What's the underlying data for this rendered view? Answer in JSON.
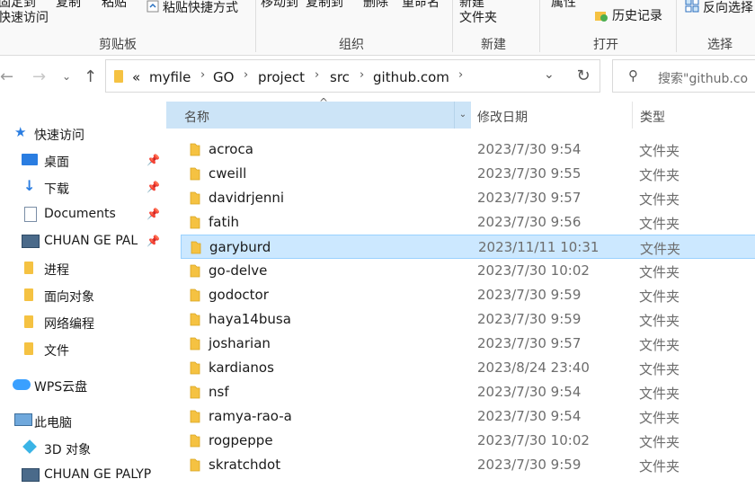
{
  "ribbon": {
    "top_texts": [
      "固定到",
      "复制",
      "粘贴",
      "移动到",
      "复制到",
      "删除",
      "重命名",
      "新建",
      "属性"
    ],
    "pin_quick_access": "快速访问",
    "paste_shortcut": "粘贴快捷方式",
    "new_folder": "文件夹",
    "history": "历史记录",
    "invert_selection": "反向选择",
    "groups": {
      "clipboard": "剪贴板",
      "organize": "组织",
      "new": "新建",
      "open": "打开",
      "select": "选择"
    }
  },
  "address": {
    "overflow": "«",
    "crumbs": [
      "myfile",
      "GO",
      "project",
      "src",
      "github.com"
    ],
    "search_placeholder": "搜索\"github.co"
  },
  "nav": {
    "quick_access": "快速访问",
    "desktop": "桌面",
    "downloads": "下载",
    "documents": "Documents",
    "chuan1": "CHUAN GE PAL",
    "process": "进程",
    "oop": "面向对象",
    "network": "网络编程",
    "file": "文件",
    "wps": "WPS云盘",
    "this_pc": "此电脑",
    "objects3d": "3D 对象",
    "chuan2": "CHUAN GE PALYP"
  },
  "columns": {
    "name": "名称",
    "date": "修改日期",
    "type": "类型"
  },
  "files": [
    {
      "name": "acroca",
      "date": "2023/7/30 9:54",
      "type": "文件夹"
    },
    {
      "name": "cweill",
      "date": "2023/7/30 9:55",
      "type": "文件夹"
    },
    {
      "name": "davidrjenni",
      "date": "2023/7/30 9:57",
      "type": "文件夹"
    },
    {
      "name": "fatih",
      "date": "2023/7/30 9:56",
      "type": "文件夹"
    },
    {
      "name": "garyburd",
      "date": "2023/11/11 10:31",
      "type": "文件夹",
      "selected": true
    },
    {
      "name": "go-delve",
      "date": "2023/7/30 10:02",
      "type": "文件夹"
    },
    {
      "name": "godoctor",
      "date": "2023/7/30 9:59",
      "type": "文件夹"
    },
    {
      "name": "haya14busa",
      "date": "2023/7/30 9:59",
      "type": "文件夹"
    },
    {
      "name": "josharian",
      "date": "2023/7/30 9:57",
      "type": "文件夹"
    },
    {
      "name": "kardianos",
      "date": "2023/8/24 23:40",
      "type": "文件夹"
    },
    {
      "name": "nsf",
      "date": "2023/7/30 9:54",
      "type": "文件夹"
    },
    {
      "name": "ramya-rao-a",
      "date": "2023/7/30 9:54",
      "type": "文件夹"
    },
    {
      "name": "rogpeppe",
      "date": "2023/7/30 10:02",
      "type": "文件夹"
    },
    {
      "name": "skratchdot",
      "date": "2023/7/30 9:59",
      "type": "文件夹"
    }
  ],
  "colors": {
    "selected_row": "#cce8ff",
    "header_highlight": "#cce4f7",
    "folder": "#f5c242"
  }
}
